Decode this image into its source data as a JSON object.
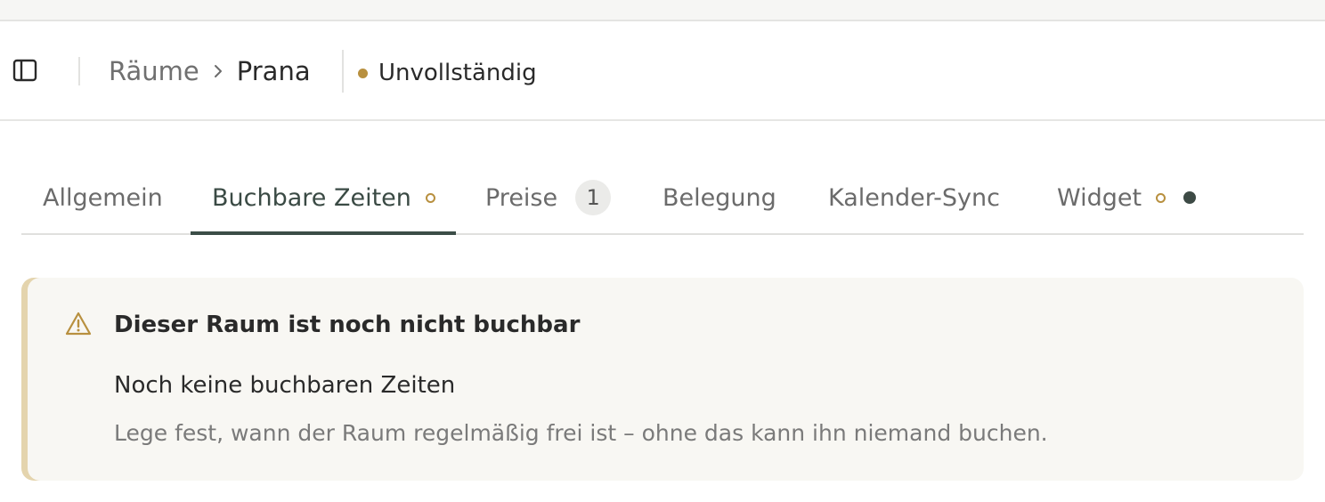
{
  "header": {
    "breadcrumb": {
      "parent": "Räume",
      "separator_icon": "chevron-right-icon",
      "current": "Prana"
    },
    "status": {
      "label": "Unvollständig",
      "color": "#b8903f"
    },
    "sidebar_toggle_icon": "sidebar-panel-icon"
  },
  "tabs": [
    {
      "label": "Allgemein",
      "active": false
    },
    {
      "label": "Buchbare Zeiten",
      "active": true,
      "indicator": "incomplete-ring"
    },
    {
      "label": "Preise",
      "active": false,
      "badge": "1"
    },
    {
      "label": "Belegung",
      "active": false
    },
    {
      "label": "Kalender-Sync",
      "active": false
    },
    {
      "label": "Widget",
      "active": false,
      "indicator": "incomplete-ring",
      "extra_indicator": "dot"
    }
  ],
  "alert": {
    "icon": "warning-triangle-icon",
    "title": "Dieser Raum ist noch nicht buchbar",
    "subtitle": "Noch keine buchbaren Zeiten",
    "description": "Lege fest, wann der Raum regelmäßig frei ist – ohne das kann ihn niemand buchen.",
    "accent_color": "#e4d4ad",
    "icon_color": "#b8903f"
  },
  "colors": {
    "active_tab_underline": "#3b4d47",
    "incomplete_indicator": "#b8903f",
    "alert_background": "#f8f7f3"
  }
}
